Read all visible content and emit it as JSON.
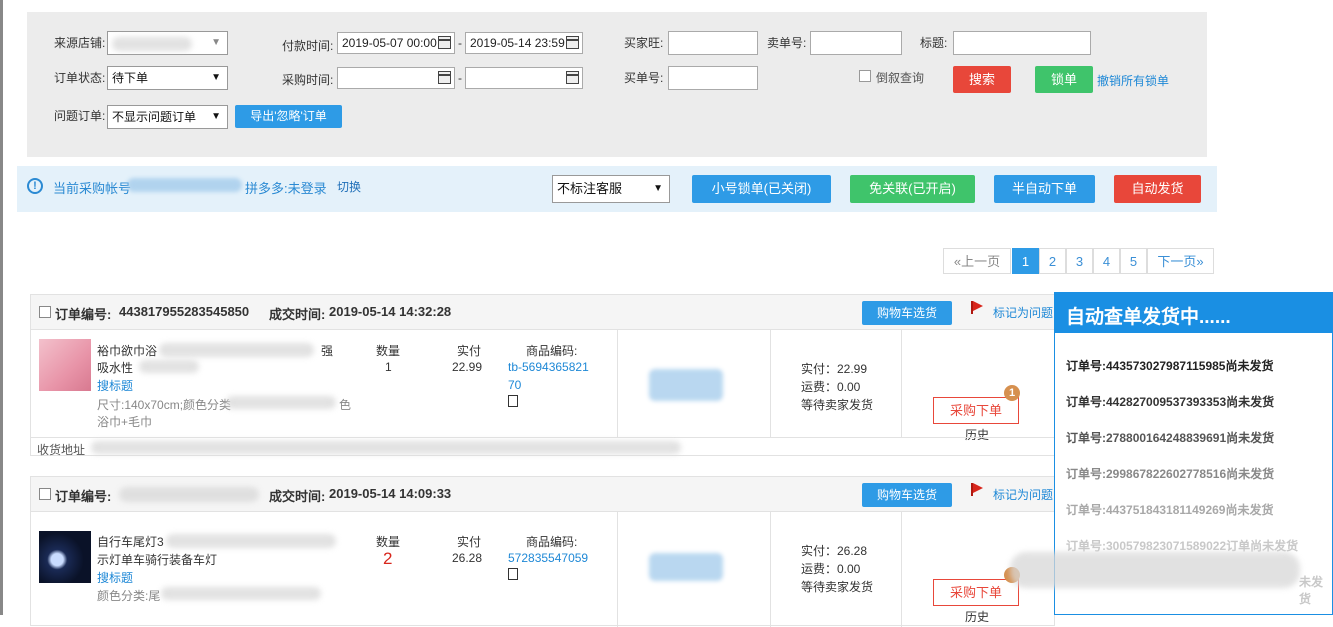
{
  "filters": {
    "source_store_label": "来源店铺:",
    "pay_time_label": "付款时间:",
    "pay_time_start": "2019-05-07 00:00",
    "pay_time_end": "2019-05-14 23:59",
    "buyer_wang_label": "买家旺:",
    "seller_no_label": "卖单号:",
    "title_label": "标题:",
    "order_status_label": "订单状态:",
    "order_status_value": "待下单",
    "purchase_time_label": "采购时间:",
    "buy_no_label": "买单号:",
    "reverse_query_label": "倒叙查询",
    "search_button": "搜索",
    "lock_button": "锁单",
    "cancel_all_locks_link": "撤销所有锁单",
    "problem_order_label": "问题订单:",
    "problem_order_value": "不显示问题订单",
    "export_button": "导出'忽略'订单"
  },
  "account_bar": {
    "current_account_label": "当前采购帐号",
    "pdd_status": "拼多多:未登录",
    "switch_link": "切换",
    "service_select": "不标注客服",
    "small_lock_button": "小号锁单(已关闭)",
    "free_link_button": "免关联(已开启)",
    "semi_auto_button": "半自动下单",
    "auto_ship_button": "自动发货"
  },
  "pagination": {
    "prev": "«上一页",
    "pages": [
      "1",
      "2",
      "3",
      "4",
      "5"
    ],
    "current": "1",
    "next": "下一页»"
  },
  "orders": [
    {
      "order_no_label": "订单编号:",
      "order_no": "443817955283545850",
      "deal_time_label": "成交时间:",
      "deal_time": "2019-05-14 14:32:28",
      "cart_button": "购物车选货",
      "mark_problem": "标记为问题",
      "product_line1": "裕巾欲巾浴",
      "product_line1_tail": "强",
      "product_line2": "吸水性",
      "search_title_link": "搜标题",
      "spec_line": "尺寸:140x70cm;颜色分类",
      "spec_tail": "色",
      "spec_line2": "浴巾+毛巾",
      "qty_label": "数量",
      "qty": "1",
      "paid_label": "实付",
      "paid": "22.99",
      "code_label": "商品编码:",
      "code_line1": "tb-5694365821",
      "code_line2": "70",
      "summary_paid": "实付：22.99",
      "summary_freight": "运费：0.00",
      "summary_status": "等待卖家发货",
      "purchase_button": "采购下单",
      "history": "历史",
      "badge": "1",
      "address_label": "收货地址"
    },
    {
      "order_no_label": "订单编号:",
      "order_no": "",
      "deal_time_label": "成交时间:",
      "deal_time": "2019-05-14 14:09:33",
      "cart_button": "购物车选货",
      "mark_problem": "标记为问题",
      "product_line1": "自行车尾灯3",
      "product_line2": "示灯单车骑行装备车灯",
      "search_title_link": "搜标题",
      "spec_line": "颜色分类:尾",
      "qty_label": "数量",
      "qty": "2",
      "paid_label": "实付",
      "paid": "26.28",
      "code_label": "商品编码:",
      "code_line1": "572835547059",
      "summary_paid": "实付：26.28",
      "summary_freight": "运费：0.00",
      "summary_status": "等待卖家发货",
      "purchase_button": "采购下单",
      "history": "历史"
    }
  ],
  "auto_panel": {
    "title": "自动查单发货中......",
    "lines": [
      "订单号:443573027987115985尚未发货",
      "订单号:442827009537393353尚未发货",
      "订单号:278800164248839691尚未发货",
      "订单号:299867822602778516尚未发货",
      "订单号:443751843181149269尚未发货",
      "订单号:300579823071589022订单尚未发货"
    ],
    "last_fragment": "未发货"
  },
  "colors": {
    "blue_button": "#2e9be6",
    "red_button": "#e8473a",
    "green_button": "#3fc46b",
    "panel_header": "#1a8fe3"
  }
}
